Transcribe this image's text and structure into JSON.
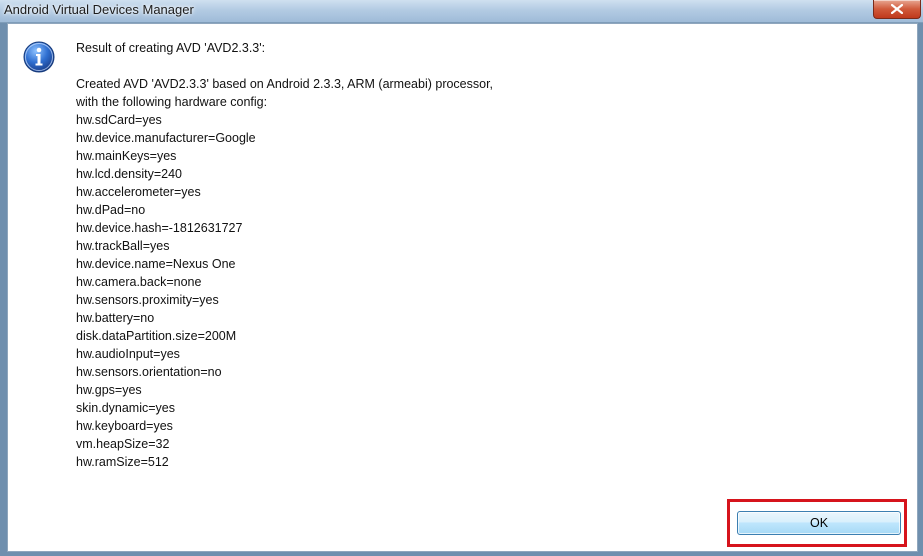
{
  "window": {
    "title": "Android Virtual Devices Manager",
    "close_icon": "close-icon"
  },
  "dialog": {
    "icon": "info-icon",
    "heading": "Result of creating AVD 'AVD2.3.3':",
    "intro_lines": [
      "Created AVD 'AVD2.3.3' based on Android 2.3.3, ARM (armeabi) processor,",
      "with the following hardware config:"
    ],
    "config_lines": [
      "hw.sdCard=yes",
      "hw.device.manufacturer=Google",
      "hw.mainKeys=yes",
      "hw.lcd.density=240",
      "hw.accelerometer=yes",
      "hw.dPad=no",
      "hw.device.hash=-1812631727",
      "hw.trackBall=yes",
      "hw.device.name=Nexus One",
      "hw.camera.back=none",
      "hw.sensors.proximity=yes",
      "hw.battery=no",
      "disk.dataPartition.size=200M",
      "hw.audioInput=yes",
      "hw.sensors.orientation=no",
      "hw.gps=yes",
      "skin.dynamic=yes",
      "hw.keyboard=yes",
      "vm.heapSize=32",
      "hw.ramSize=512"
    ],
    "ok_label": "OK",
    "highlight_color": "#d6141c"
  }
}
